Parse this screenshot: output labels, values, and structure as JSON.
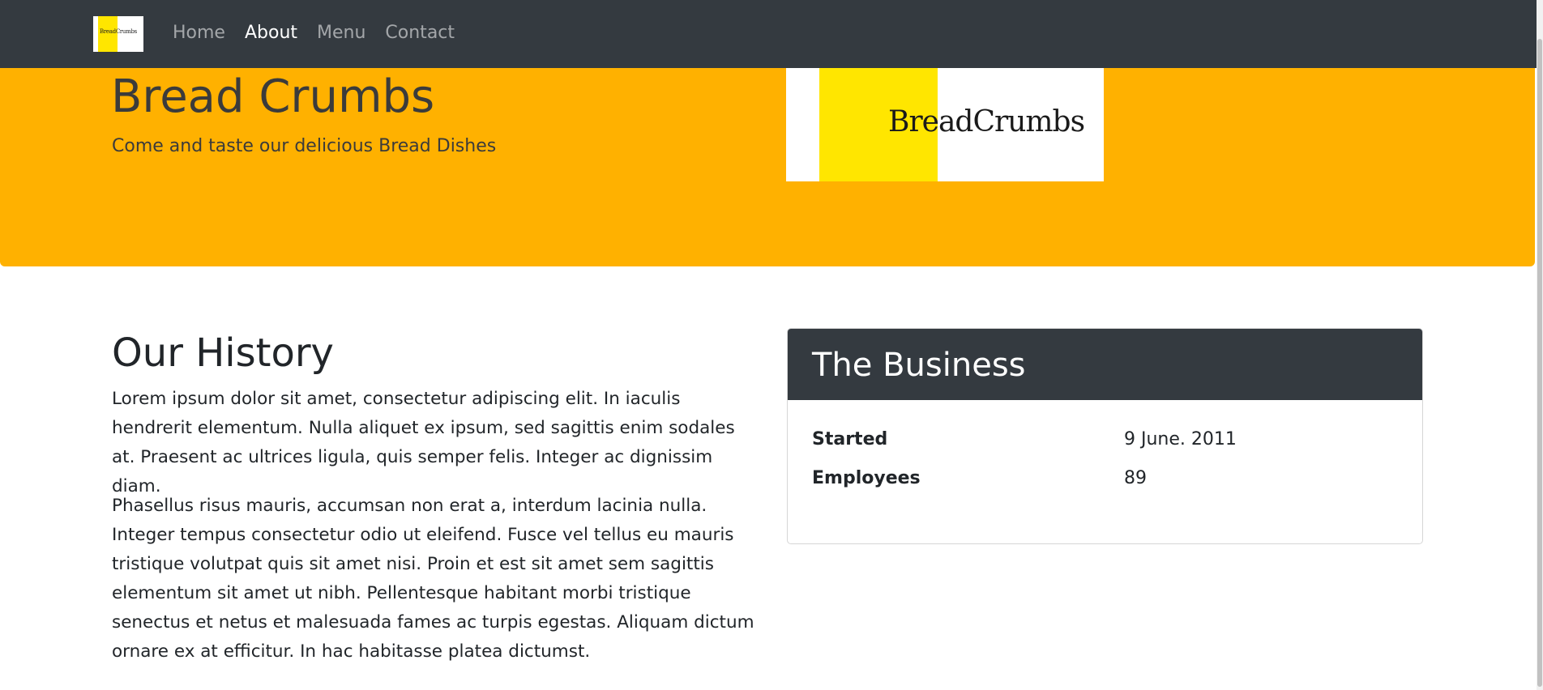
{
  "navbar": {
    "logo_text": "BreadCrumbs",
    "links": [
      {
        "label": "Home",
        "active": false
      },
      {
        "label": "About",
        "active": true
      },
      {
        "label": "Menu",
        "active": false
      },
      {
        "label": "Contact",
        "active": false
      }
    ],
    "background_color": "#343a40"
  },
  "hero": {
    "title": "Bread Crumbs",
    "subtitle": "Come and taste our delicious Bread Dishes",
    "logo_text": "BreadCrumbs",
    "background_color": "#ffb100"
  },
  "history": {
    "title": "Our History",
    "paragraphs": [
      "Lorem ipsum dolor sit amet, consectetur adipiscing elit. In iaculis hendrerit elementum. Nulla aliquet ex ipsum, sed sagittis enim sodales at. Praesent ac ultrices ligula, quis semper felis. Integer ac dignissim diam.",
      "Phasellus risus mauris, accumsan non erat a, interdum lacinia nulla. Integer tempus consectetur odio ut eleifend. Fusce vel tellus eu mauris tristique volutpat quis sit amet nisi. Proin et est sit amet sem sagittis elementum sit amet ut nibh. Pellentesque habitant morbi tristique senectus et netus et malesuada fames ac turpis egestas. Aliquam dictum ornare ex at efficitur. In hac habitasse platea dictumst."
    ]
  },
  "business": {
    "title": "The Business",
    "rows": [
      {
        "label": "Started",
        "value": "9 June. 2011"
      },
      {
        "label": "Employees",
        "value": "89"
      }
    ]
  }
}
